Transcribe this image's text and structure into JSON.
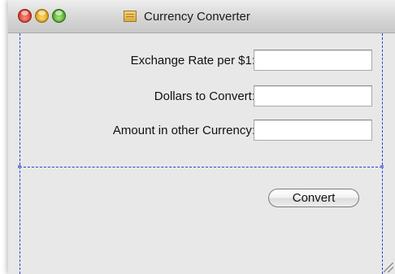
{
  "window": {
    "title": "Currency Converter",
    "title_icon": "document-icon",
    "traffic_lights": [
      "close",
      "minimize",
      "zoom"
    ]
  },
  "form": {
    "rows": [
      {
        "label": "Exchange Rate per $1:",
        "value": ""
      },
      {
        "label": "Dollars to Convert:",
        "value": ""
      },
      {
        "label": "Amount in other Currency:",
        "value": ""
      }
    ],
    "convert_label": "Convert"
  },
  "colors": {
    "guide": "#2d3fd8",
    "window_bg": "#e8e8e8"
  }
}
